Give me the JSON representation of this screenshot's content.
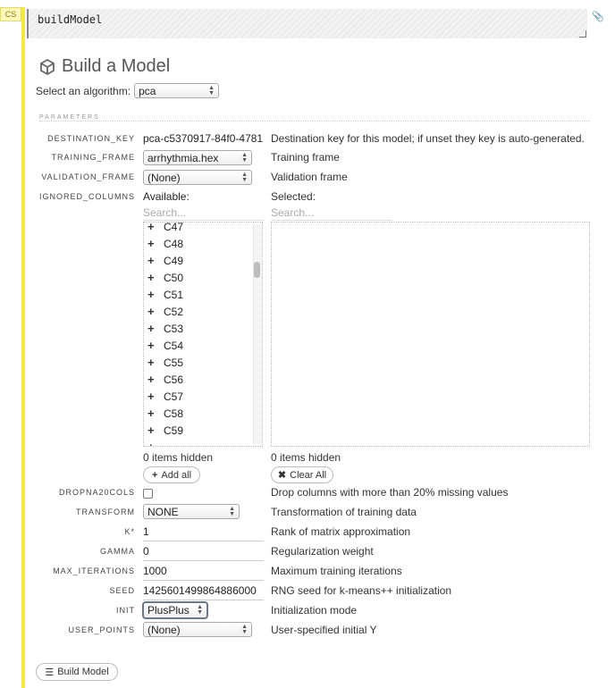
{
  "cell": {
    "tag": "CS",
    "code": "buildModel"
  },
  "header": {
    "title": "Build a Model",
    "algorithm_label": "Select an algorithm:",
    "algorithm_value": "pca"
  },
  "section": {
    "parameters_label": "PARAMETERS"
  },
  "params": {
    "destination_key": {
      "label": "DESTINATION_KEY",
      "value": "pca-c5370917-84f0-4781",
      "help": "Destination key for this model; if unset they key is auto-generated."
    },
    "training_frame": {
      "label": "TRAINING_FRAME",
      "value": "arrhythmia.hex",
      "help": "Training frame"
    },
    "validation_frame": {
      "label": "VALIDATION_FRAME",
      "value": "(None)",
      "help": "Validation frame"
    },
    "ignored_columns": {
      "label": "IGNORED_COLUMNS",
      "available_label": "Available:",
      "selected_label": "Selected:",
      "search_placeholder": "Search...",
      "available_items": [
        "C47",
        "C48",
        "C49",
        "C50",
        "C51",
        "C52",
        "C53",
        "C54",
        "C55",
        "C56",
        "C57",
        "C58",
        "C59"
      ],
      "available_hidden": "0 items hidden",
      "selected_hidden": "0 items hidden",
      "add_all_label": "Add all",
      "clear_all_label": "Clear All"
    },
    "dropna20cols": {
      "label": "DROPNA20COLS",
      "help": "Drop columns with more than 20% missing values",
      "checked": false
    },
    "transform": {
      "label": "TRANSFORM",
      "value": "NONE",
      "help": "Transformation of training data"
    },
    "k": {
      "label": "K*",
      "value": "1",
      "help": "Rank of matrix approximation"
    },
    "gamma": {
      "label": "GAMMA",
      "value": "0",
      "help": "Regularization weight"
    },
    "max_iterations": {
      "label": "MAX_ITERATIONS",
      "value": "1000",
      "help": "Maximum training iterations"
    },
    "seed": {
      "label": "SEED",
      "value": "1425601499864886000",
      "help": "RNG seed for k-means++ initialization"
    },
    "init": {
      "label": "INIT",
      "value": "PlusPlus",
      "help": "Initialization mode"
    },
    "user_points": {
      "label": "USER_POINTS",
      "value": "(None)",
      "help": "User-specified initial Y"
    }
  },
  "footer": {
    "build_label": "Build Model"
  },
  "colors": {
    "gutter": "#f4ea3f",
    "tag_bg": "#fff9b8"
  }
}
